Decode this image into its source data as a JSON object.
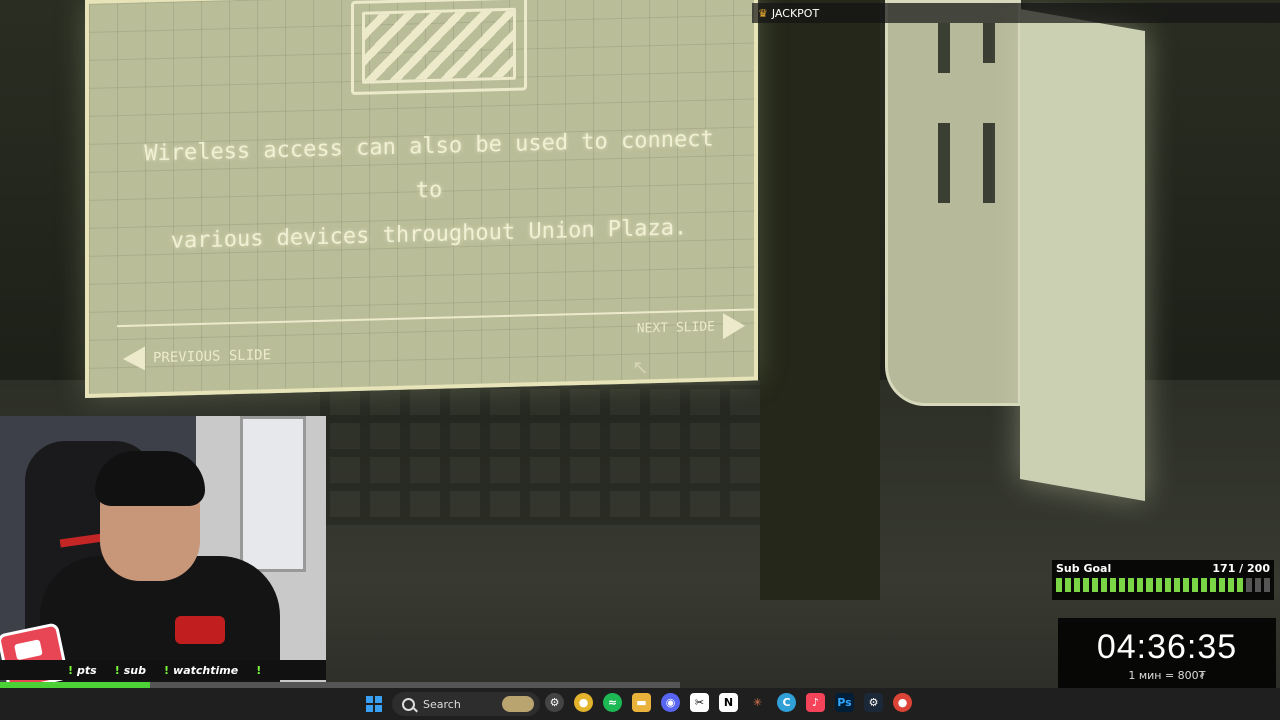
{
  "game": {
    "slide_text_line1": "Wireless access can also be used to connect to",
    "slide_text_line2": "various devices throughout Union Plaza.",
    "prev_slide_label": "PREVIOUS SLIDE",
    "next_slide_label": "NEXT SLIDE",
    "logo_icon": "union-plaza-logo-icon"
  },
  "stream_overlay": {
    "jackpot_label": "JACKPOT",
    "commands": [
      {
        "bang": "!",
        "label": "pts"
      },
      {
        "bang": "!",
        "label": "sub"
      },
      {
        "bang": "!",
        "label": "watchtime"
      },
      {
        "bang": "!",
        "label": ""
      }
    ],
    "sub_goal": {
      "title": "Sub Goal",
      "count_text": "171 / 200",
      "current": 171,
      "target": 200
    },
    "timer": "04:36:35",
    "timer_rate": "1 мин = 800₮",
    "progress_fraction": 0.22
  },
  "taskbar": {
    "search_placeholder": "Search",
    "icons": [
      "windows-start-icon",
      "search-icon",
      "news-widget-icon",
      "settings-icon",
      "chrome-icon",
      "spotify-icon",
      "file-explorer-icon",
      "discord-icon",
      "capcut-icon",
      "notion-icon",
      "claude-icon",
      "c-app-icon",
      "music-icon",
      "photoshop-icon",
      "steam-icon",
      "chrome-alt-icon"
    ],
    "colors": {
      "accent": "#3aa0f3",
      "subgoal_fill": "#7bd645"
    }
  }
}
